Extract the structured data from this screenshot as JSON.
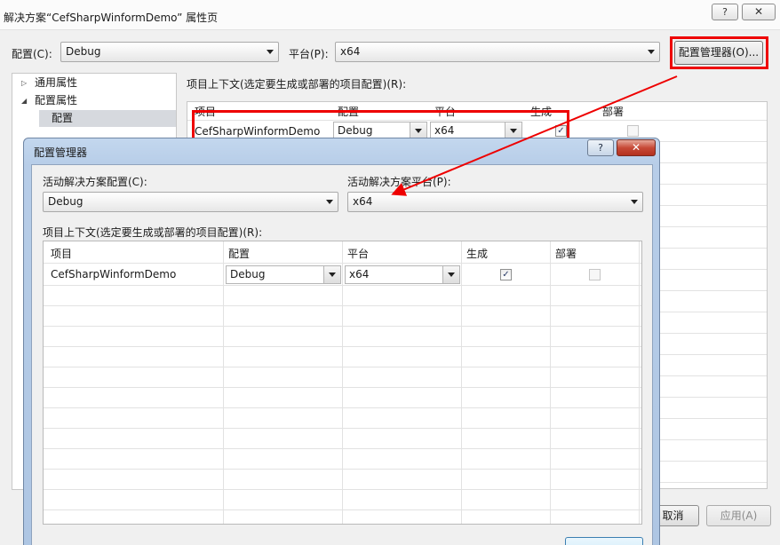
{
  "outer": {
    "title": "解决方案“CefSharpWinformDemo” 属性页",
    "help_glyph": "?",
    "close_glyph": "✕",
    "config_label": "配置(C):",
    "config_value": "Debug",
    "platform_label": "平台(P):",
    "platform_value": "x64",
    "config_manager_button": "配置管理器(O)...",
    "tree": {
      "item_common": "通用属性",
      "item_config_props": "配置属性",
      "item_config": "配置"
    },
    "context_label": "项目上下文(选定要生成或部署的项目配置)(R):",
    "grid": {
      "headers": [
        "项目",
        "配置",
        "平台",
        "生成",
        "部署"
      ],
      "row": {
        "project": "CefSharpWinformDemo",
        "config": "Debug",
        "platform": "x64",
        "build": true,
        "deploy": false
      }
    },
    "cancel_button": "取消",
    "apply_button": "应用(A)"
  },
  "inner": {
    "title": "配置管理器",
    "help_glyph": "?",
    "close_glyph": "✕",
    "active_config_label": "活动解决方案配置(C):",
    "active_config_value": "Debug",
    "active_platform_label": "活动解决方案平台(P):",
    "active_platform_value": "x64",
    "context_label": "项目上下文(选定要生成或部署的项目配置)(R):",
    "grid": {
      "headers": [
        "项目",
        "配置",
        "平台",
        "生成",
        "部署"
      ],
      "row": {
        "project": "CefSharpWinformDemo",
        "config": "Debug",
        "platform": "x64",
        "build": true,
        "deploy": false
      }
    }
  },
  "colors": {
    "highlight": "#ee0000",
    "dialog_frame": "#aec6e3"
  },
  "icons": {
    "check": "✓",
    "expand": "▷",
    "collapse": "◢"
  }
}
